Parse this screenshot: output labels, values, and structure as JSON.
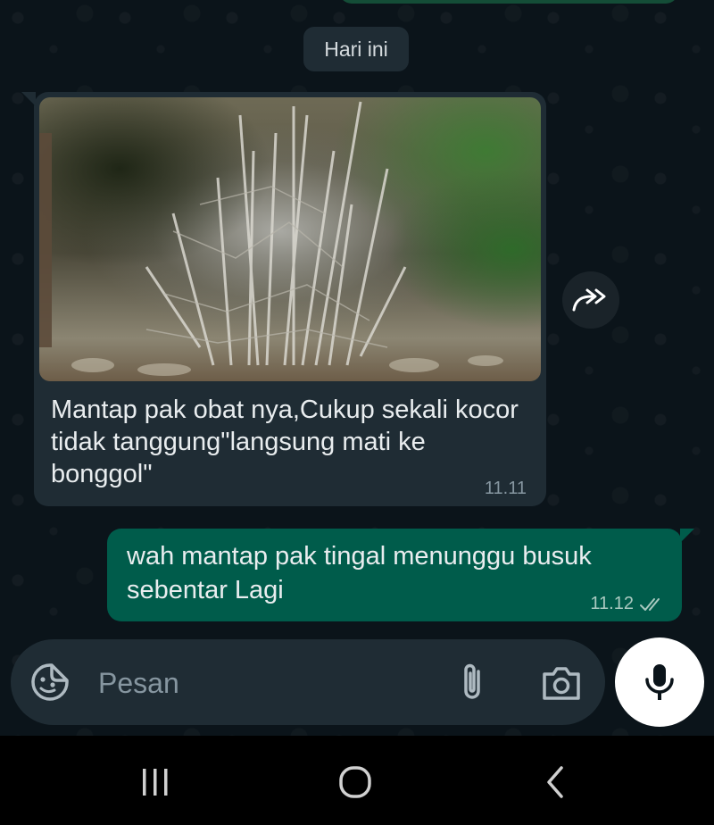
{
  "date_chip": "Hari ini",
  "messages": [
    {
      "direction": "incoming",
      "has_photo": true,
      "text": "Mantap pak obat nya,Cukup sekali kocor tidak tanggung\"langsung mati ke bonggol\"",
      "time": "11.11"
    },
    {
      "direction": "outgoing",
      "text": "wah mantap pak tingal menunggu busuk sebentar Lagi",
      "time": "11.12",
      "status_icon": "double-check-icon"
    }
  ],
  "composer": {
    "placeholder": "Pesan",
    "icons": [
      "sticker-icon",
      "paperclip-icon",
      "camera-icon",
      "microphone-icon"
    ]
  },
  "forward_icon": "forward-icon",
  "nav_icons": [
    "recent-apps-icon",
    "home-icon",
    "back-icon"
  ],
  "colors": {
    "background": "#0b141a",
    "incoming_bubble": "#1f2c34",
    "outgoing_bubble": "#005c4b",
    "text": "#e9edef",
    "meta_text": "#8696a0"
  }
}
